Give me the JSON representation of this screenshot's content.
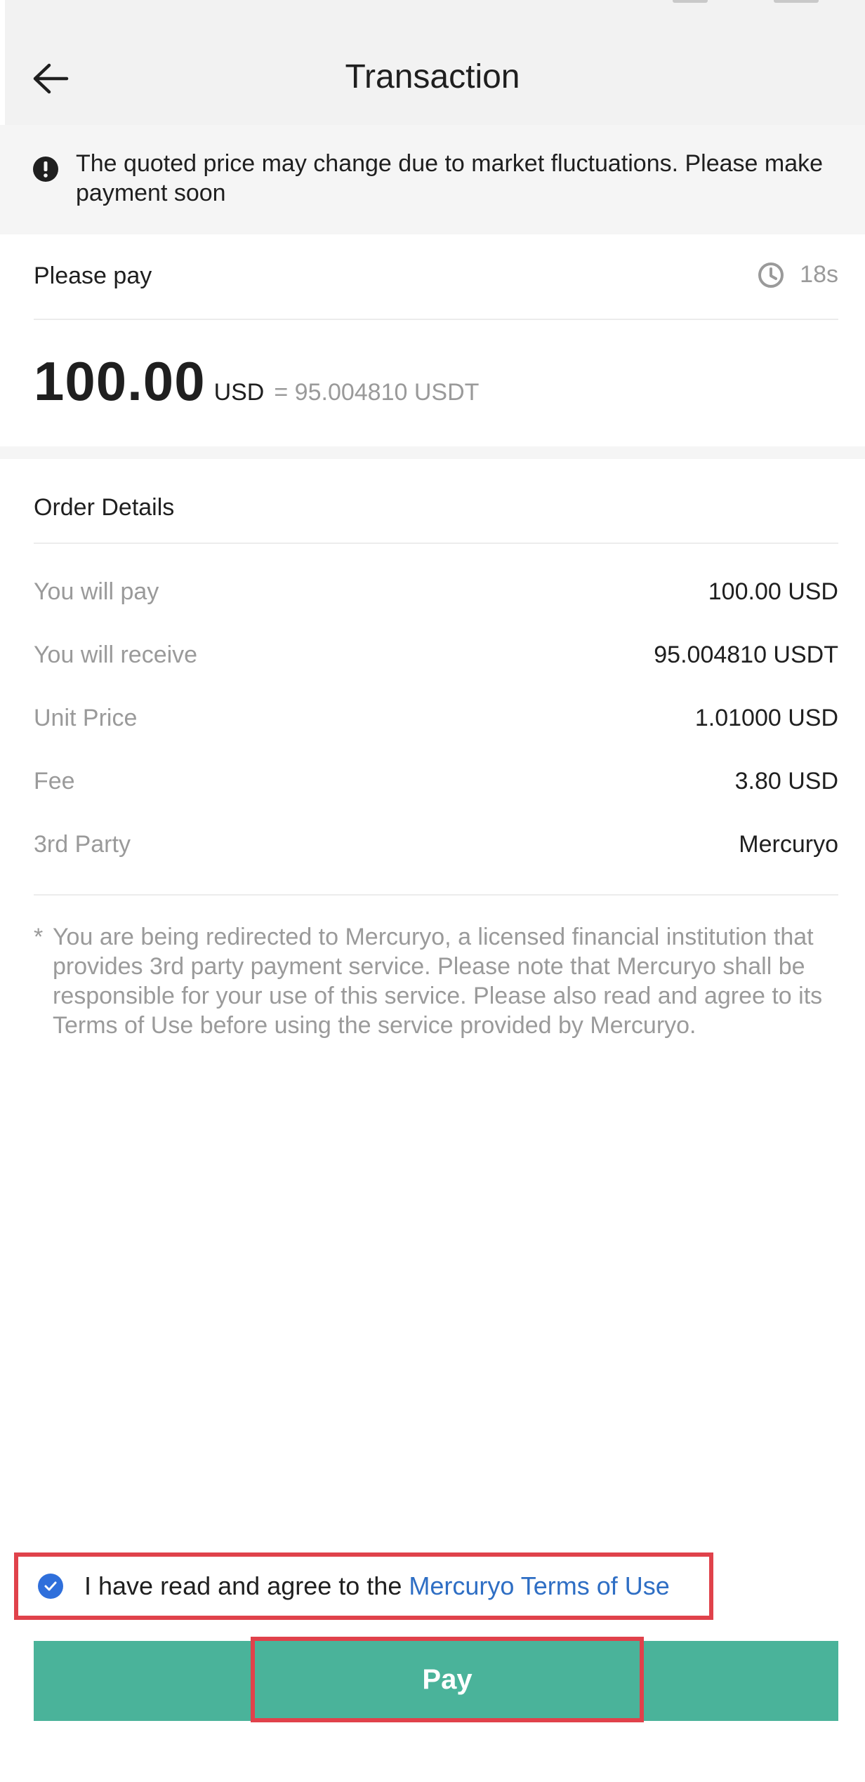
{
  "header": {
    "title": "Transaction",
    "back_icon": "arrow-left-icon"
  },
  "notice": {
    "icon": "alert-circle-icon",
    "text": "The quoted price may change due to market fluctuations. Please make payment soon"
  },
  "payment": {
    "label": "Please pay",
    "timer_icon": "clock-icon",
    "countdown": "18s",
    "amount": "100.00",
    "currency": "USD",
    "equivalent": "= 95.004810 USDT"
  },
  "order": {
    "title": "Order Details",
    "rows": [
      {
        "label": "You will pay",
        "value": "100.00 USD"
      },
      {
        "label": "You will receive",
        "value": "95.004810 USDT"
      },
      {
        "label": "Unit Price",
        "value": "1.01000 USD"
      },
      {
        "label": "Fee",
        "value": "3.80 USD"
      },
      {
        "label": "3rd Party",
        "value": "Mercuryo"
      }
    ]
  },
  "disclaimer": {
    "marker": "*",
    "text": "You are being redirected to Mercuryo, a licensed financial institution that provides 3rd party payment service. Please note that Mercuryo shall be responsible for your use of this service. Please also read and agree to its Terms of Use before using the service provided by Mercuryo."
  },
  "agreement": {
    "checked": true,
    "text": "I have read and agree to the",
    "link": "Mercuryo Terms of Use"
  },
  "actions": {
    "pay_label": "Pay"
  },
  "colors": {
    "accent": "#4ab39a",
    "link": "#2e6ec4",
    "checkbox": "#2f6fdb",
    "highlight_border": "#e0424b"
  }
}
